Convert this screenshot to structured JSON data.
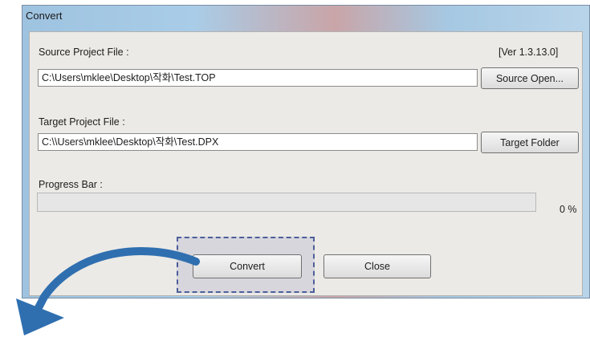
{
  "window": {
    "title": "Convert"
  },
  "version": "[Ver 1.3.13.0]",
  "source": {
    "label": "Source Project File :",
    "path": "C:\\Users\\mklee\\Desktop\\작화\\Test.TOP",
    "button": "Source Open..."
  },
  "target": {
    "label": "Target Project File :",
    "path": "C:\\\\Users\\mklee\\Desktop\\작화\\Test.DPX",
    "button": "Target Folder"
  },
  "progress": {
    "label": "Progress Bar :",
    "value": 0,
    "text": "0 %"
  },
  "buttons": {
    "convert": "Convert",
    "close": "Close"
  },
  "colors": {
    "highlight_border": "#4b5f9a",
    "arrow": "#2f6fb0"
  }
}
